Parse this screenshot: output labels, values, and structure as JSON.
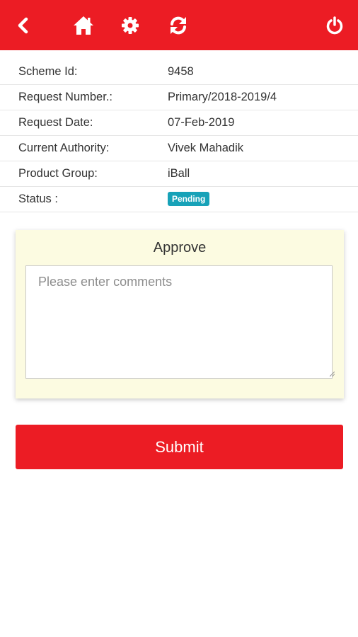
{
  "colors": {
    "brand_red": "#ec1c24",
    "pending_badge": "#17a2b8",
    "card_background": "#fcfbe1"
  },
  "toolbar": {
    "icons": [
      "back-icon",
      "home-icon",
      "gear-icon",
      "refresh-icon",
      "power-icon"
    ]
  },
  "details": {
    "scheme_id": {
      "label": "Scheme Id:",
      "value": "9458"
    },
    "request_number": {
      "label": "Request Number.:",
      "value": "Primary/2018-2019/4"
    },
    "request_date": {
      "label": "Request Date:",
      "value": "07-Feb-2019"
    },
    "current_authority": {
      "label": "Current Authority:",
      "value": "Vivek Mahadik"
    },
    "product_group": {
      "label": "Product Group:",
      "value": "iBall"
    },
    "status": {
      "label": "Status :",
      "value": "Pending"
    }
  },
  "approve": {
    "title": "Approve",
    "comment_value": "",
    "comment_placeholder": "Please enter comments"
  },
  "submit_label": "Submit"
}
